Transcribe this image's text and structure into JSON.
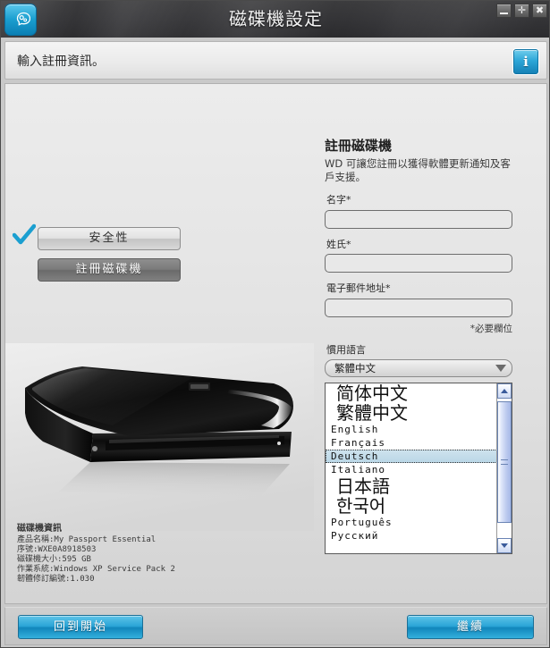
{
  "window": {
    "title": "磁碟機設定",
    "logo_icon": "wd-smartware-head-icon",
    "controls": {
      "minimize": "minimize-icon",
      "maximize": "maximize-icon",
      "close": "close-icon"
    }
  },
  "instruction": {
    "text": "輸入註冊資訊。",
    "info_icon": "i"
  },
  "steps": [
    {
      "label": "安全性",
      "state": "completed",
      "check_icon": "checkmark-icon"
    },
    {
      "label": "註冊磁碟機",
      "state": "active"
    }
  ],
  "drive_image": {
    "alt": "my-passport-essential-portable-drive"
  },
  "drive_info": {
    "title": "磁碟機資訊",
    "lines": [
      "產品名稱:My Passport Essential",
      "序號:WXE0A8918503",
      "磁碟機大小:595 GB",
      "作業系統:Windows XP Service Pack 2",
      "韌體修訂編號:1.030"
    ]
  },
  "registration": {
    "title": "註冊磁碟機",
    "description": "WD 可讓您註冊以獲得軟體更新通知及客戶支援。",
    "fields": [
      {
        "label": "名字*",
        "value": "",
        "placeholder": ""
      },
      {
        "label": "姓氏*",
        "value": "",
        "placeholder": ""
      },
      {
        "label": "電子郵件地址*",
        "value": "",
        "placeholder": ""
      }
    ],
    "required_note": "*必要欄位",
    "language": {
      "label": "慣用語言",
      "selected": "繁體中文",
      "options": [
        {
          "text": "简体中文",
          "cjk": true,
          "selected": false
        },
        {
          "text": "繁體中文",
          "cjk": true,
          "selected": false
        },
        {
          "text": "English",
          "cjk": false,
          "selected": false
        },
        {
          "text": "Français",
          "cjk": false,
          "selected": false
        },
        {
          "text": "Deutsch",
          "cjk": false,
          "selected": true
        },
        {
          "text": "Italiano",
          "cjk": false,
          "selected": false
        },
        {
          "text": "日本語",
          "cjk": true,
          "selected": false
        },
        {
          "text": "한국어",
          "cjk": true,
          "selected": false
        },
        {
          "text": "Português",
          "cjk": false,
          "selected": false
        },
        {
          "text": "Русский",
          "cjk": false,
          "selected": false
        }
      ]
    }
  },
  "footer": {
    "back_label": "回到開始",
    "next_label": "繼續"
  },
  "colors": {
    "accent_blue": "#2ba5d7",
    "checkmark_blue": "#1b9fd0",
    "titlebar": "#37373a",
    "panel": "#e4e4e4"
  }
}
